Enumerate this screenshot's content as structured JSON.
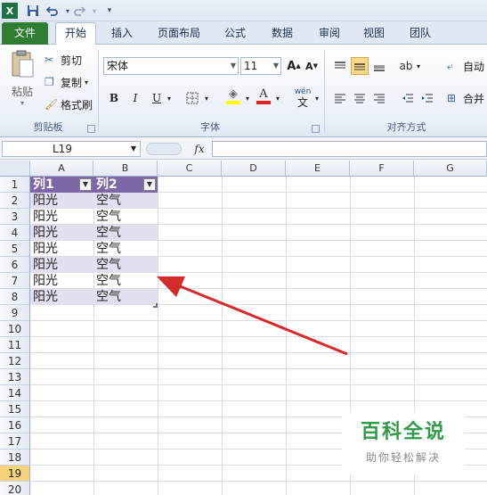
{
  "qat": {
    "app_icon": "excel-icon",
    "save_icon": "save-icon",
    "undo_icon": "undo-icon",
    "redo_icon": "redo-icon",
    "customize_icon": "customize-qat-icon"
  },
  "tabs": [
    {
      "label": "文件"
    },
    {
      "label": "开始"
    },
    {
      "label": "插入"
    },
    {
      "label": "页面布局"
    },
    {
      "label": "公式"
    },
    {
      "label": "数据"
    },
    {
      "label": "审阅"
    },
    {
      "label": "视图"
    },
    {
      "label": "团队"
    }
  ],
  "ribbon": {
    "clipboard": {
      "paste": "粘贴",
      "cut": "剪切",
      "copy": "复制",
      "format_painter": "格式刷",
      "group": "剪贴板"
    },
    "font": {
      "name": "宋体",
      "size": "11",
      "bold": "B",
      "italic": "I",
      "underline": "U",
      "grow": "A",
      "shrink": "A",
      "font_color": "A",
      "wen": "wén",
      "wen_char": "文",
      "group": "字体"
    },
    "alignment": {
      "auto": "自动",
      "merge": "合并",
      "group": "对齐方式"
    }
  },
  "formula_bar": {
    "name_box": "L19",
    "fx": "fx",
    "value": ""
  },
  "sheet": {
    "columns": [
      "A",
      "B",
      "C",
      "D",
      "E",
      "F",
      "G"
    ],
    "rows": [
      "1",
      "2",
      "3",
      "4",
      "5",
      "6",
      "7",
      "8",
      "9",
      "10",
      "11",
      "12",
      "13",
      "14",
      "15",
      "16",
      "17",
      "18",
      "19",
      "20"
    ],
    "selected_row": "19",
    "table": {
      "headers": [
        "列1",
        "列2"
      ],
      "rows": [
        [
          "阳光",
          "空气"
        ],
        [
          "阳光",
          "空气"
        ],
        [
          "阳光",
          "空气"
        ],
        [
          "阳光",
          "空气"
        ],
        [
          "阳光",
          "空气"
        ],
        [
          "阳光",
          "空气"
        ],
        [
          "阳光",
          "空气"
        ]
      ],
      "header_color": "#7d67a6",
      "band_color": "#e4dff0"
    }
  },
  "annotation": {
    "arrow_color": "#d42a2a"
  },
  "watermark": {
    "title": "百科全说",
    "subtitle": "助你轻松解决"
  }
}
